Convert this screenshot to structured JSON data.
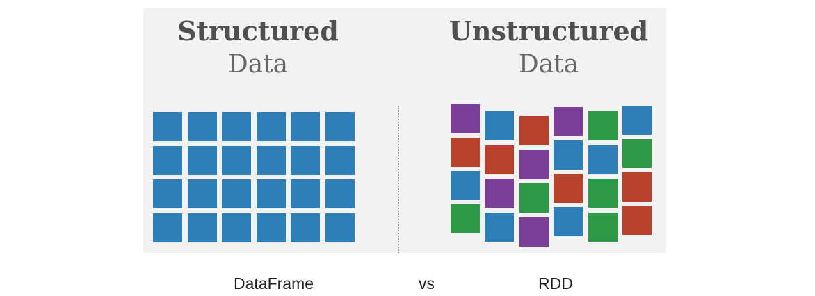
{
  "structured": {
    "title_bold": "Structured",
    "title_light": "Data",
    "rows": [
      [
        "blue",
        "blue",
        "blue",
        "blue",
        "blue",
        "blue"
      ],
      [
        "blue",
        "blue",
        "blue",
        "blue",
        "blue",
        "blue"
      ],
      [
        "blue",
        "blue",
        "blue",
        "blue",
        "blue",
        "blue"
      ],
      [
        "blue",
        "blue",
        "blue",
        "blue",
        "blue",
        "blue"
      ]
    ]
  },
  "unstructured": {
    "title_bold": "Unstructured",
    "title_light": "Data",
    "columns": [
      [
        "purple",
        "red",
        "blue",
        "green"
      ],
      [
        "blue",
        "red",
        "purple",
        "blue"
      ],
      [
        "red",
        "purple",
        "green",
        "purple"
      ],
      [
        "purple",
        "blue",
        "red",
        "blue"
      ],
      [
        "green",
        "blue",
        "green",
        "green"
      ],
      [
        "blue",
        "green",
        "red",
        "red"
      ]
    ]
  },
  "colors": {
    "blue": "#2e7fb8",
    "red": "#b8412b",
    "purple": "#7b3f9a",
    "green": "#2e9a47",
    "panel": "#f2f2f2"
  },
  "captions": {
    "left": "DataFrame",
    "middle": "vs",
    "right": "RDD"
  }
}
